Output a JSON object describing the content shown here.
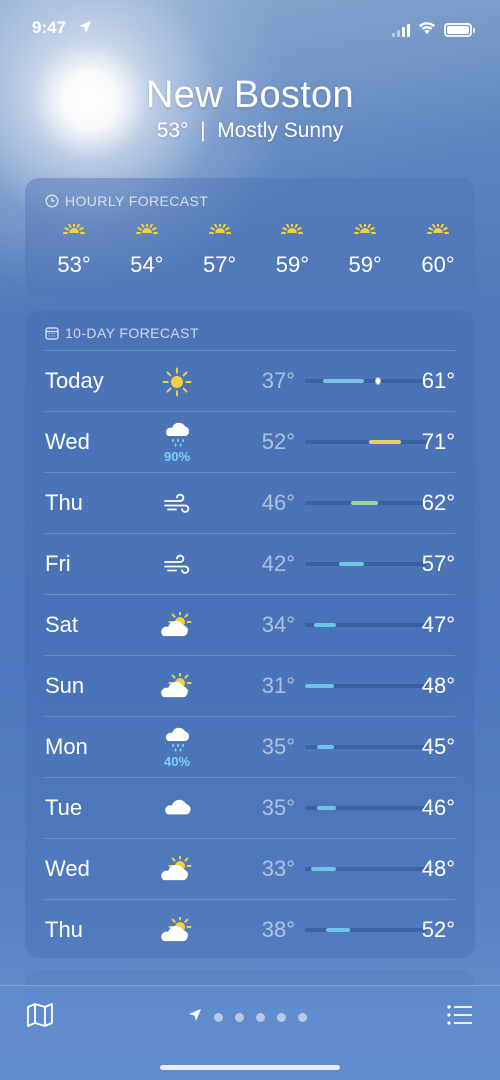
{
  "status": {
    "time": "9:47"
  },
  "location": {
    "city": "New Boston",
    "condition": "53°  |  Mostly Sunny"
  },
  "hourly": {
    "title": "HOURLY FORECAST",
    "items": [
      {
        "icon": "sun-icon",
        "temp": "53°"
      },
      {
        "icon": "sun-icon",
        "temp": "54°"
      },
      {
        "icon": "sun-icon",
        "temp": "57°"
      },
      {
        "icon": "sun-icon",
        "temp": "59°"
      },
      {
        "icon": "sun-icon",
        "temp": "59°"
      },
      {
        "icon": "sun-icon",
        "temp": "60°"
      }
    ]
  },
  "tenday": {
    "title": "10-DAY FORECAST",
    "days": [
      {
        "day": "Today",
        "icon": "sun-icon",
        "pct": "",
        "lo": "37°",
        "hi": "61°",
        "color": "#79c3e0"
      },
      {
        "day": "Wed",
        "icon": "rain-cloud-icon",
        "pct": "90%",
        "lo": "52°",
        "hi": "71°",
        "color": "#e8d25a"
      },
      {
        "day": "Thu",
        "icon": "wind-icon",
        "pct": "",
        "lo": "46°",
        "hi": "62°",
        "color": "#9ed39a"
      },
      {
        "day": "Fri",
        "icon": "wind-icon",
        "pct": "",
        "lo": "42°",
        "hi": "57°",
        "color": "#6fcad6"
      },
      {
        "day": "Sat",
        "icon": "partly-cloudy-icon",
        "pct": "",
        "lo": "34°",
        "hi": "47°",
        "color": "#6cc4e6"
      },
      {
        "day": "Sun",
        "icon": "partly-cloudy-icon",
        "pct": "",
        "lo": "31°",
        "hi": "48°",
        "color": "#6cc4e6"
      },
      {
        "day": "Mon",
        "icon": "rain-cloud-icon",
        "pct": "40%",
        "lo": "35°",
        "hi": "45°",
        "color": "#6cc4e6"
      },
      {
        "day": "Tue",
        "icon": "cloud-icon",
        "pct": "",
        "lo": "35°",
        "hi": "46°",
        "color": "#6cc4e6"
      },
      {
        "day": "Wed",
        "icon": "partly-cloudy-icon",
        "pct": "",
        "lo": "33°",
        "hi": "48°",
        "color": "#6cc4e6"
      },
      {
        "day": "Thu",
        "icon": "partly-cloudy-icon",
        "pct": "",
        "lo": "38°",
        "hi": "52°",
        "color": "#6cc4e6"
      }
    ]
  },
  "toolbar": {
    "map_icon": "map-icon",
    "list_icon": "list-icon",
    "pages": 5
  },
  "colors": {
    "sun": "#f5cf3c",
    "precip": "#7fd0f6"
  }
}
